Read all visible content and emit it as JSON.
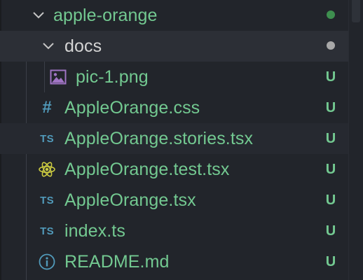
{
  "tree": {
    "root_folder": {
      "label": "apple-orange",
      "status_color": "#3e8f4f"
    },
    "docs_folder": {
      "label": "docs",
      "status_color": "#a8a8a8"
    },
    "files": [
      {
        "label": "pic-1.png",
        "icon": "image-icon",
        "status": "U"
      },
      {
        "label": "AppleOrange.css",
        "icon": "css-hash-icon",
        "status": "U",
        "icon_text": "#"
      },
      {
        "label": "AppleOrange.stories.tsx",
        "icon": "typescript-icon",
        "status": "U",
        "icon_text": "TS"
      },
      {
        "label": "AppleOrange.test.tsx",
        "icon": "react-atom-icon",
        "status": "U"
      },
      {
        "label": "AppleOrange.tsx",
        "icon": "typescript-icon",
        "status": "U",
        "icon_text": "TS"
      },
      {
        "label": "index.ts",
        "icon": "typescript-icon",
        "status": "U",
        "icon_text": "TS"
      },
      {
        "label": "README.md",
        "icon": "info-icon",
        "status": "U"
      }
    ]
  },
  "colors": {
    "background": "#22252b",
    "untracked_green": "#73c991",
    "ts_blue": "#519aba",
    "image_purple": "#a074c4",
    "react_yellow": "#cbcb41",
    "info_blue": "#519aba"
  }
}
